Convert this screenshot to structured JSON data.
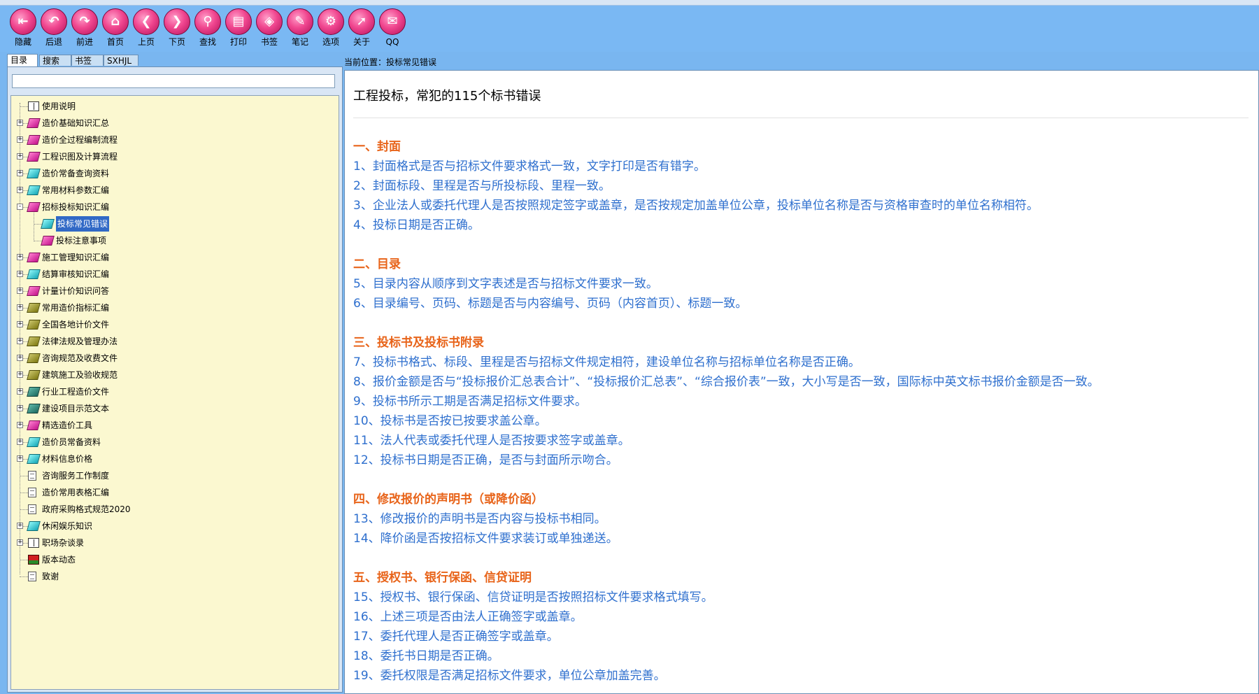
{
  "toolbar": {
    "buttons": [
      {
        "label": "隐藏",
        "icon": "hide-icon",
        "glyph": "⇤"
      },
      {
        "label": "后退",
        "icon": "back-icon",
        "glyph": "↶"
      },
      {
        "label": "前进",
        "icon": "forward-icon",
        "glyph": "↷"
      },
      {
        "label": "首页",
        "icon": "home-icon",
        "glyph": "⌂"
      },
      {
        "label": "上页",
        "icon": "prev-page-icon",
        "glyph": "❮"
      },
      {
        "label": "下页",
        "icon": "next-page-icon",
        "glyph": "❯"
      },
      {
        "label": "查找",
        "icon": "binoculars-icon",
        "glyph": "⚲"
      },
      {
        "label": "打印",
        "icon": "printer-icon",
        "glyph": "▤"
      },
      {
        "label": "书签",
        "icon": "bookmark-tag-icon",
        "glyph": "◈"
      },
      {
        "label": "笔记",
        "icon": "notes-icon",
        "glyph": "✎"
      },
      {
        "label": "选项",
        "icon": "gear-icon",
        "glyph": "⚙"
      },
      {
        "label": "关于",
        "icon": "cursor-icon",
        "glyph": "➚"
      },
      {
        "label": "QQ",
        "icon": "qq-icon",
        "glyph": "✉"
      }
    ]
  },
  "sidebar": {
    "tabs": [
      "目录",
      "搜索",
      "书签",
      "SXHJL"
    ],
    "active_tab": "目录",
    "search_value": "",
    "tree": [
      {
        "label": "使用说明",
        "icon": "book-open",
        "expander": "",
        "indent": 0
      },
      {
        "label": "造价基础知识汇总",
        "icon": "book-pink",
        "expander": "+",
        "indent": 0
      },
      {
        "label": "造价全过程编制流程",
        "icon": "book-pink",
        "expander": "+",
        "indent": 0
      },
      {
        "label": "工程识图及计算流程",
        "icon": "book-pink",
        "expander": "+",
        "indent": 0
      },
      {
        "label": "造价常备查询资料",
        "icon": "book-cyan",
        "expander": "+",
        "indent": 0
      },
      {
        "label": "常用材料参数汇编",
        "icon": "book-cyan",
        "expander": "+",
        "indent": 0
      },
      {
        "label": "招标投标知识汇编",
        "icon": "book-pink",
        "expander": "-",
        "indent": 0
      },
      {
        "label": "投标常见错误",
        "icon": "book-cyan",
        "expander": "",
        "indent": 1,
        "selected": true
      },
      {
        "label": "投标注意事项",
        "icon": "book-pink",
        "expander": "",
        "indent": 1
      },
      {
        "label": "施工管理知识汇编",
        "icon": "book-pink",
        "expander": "+",
        "indent": 0
      },
      {
        "label": "结算审核知识汇编",
        "icon": "book-cyan",
        "expander": "+",
        "indent": 0
      },
      {
        "label": "计量计价知识问答",
        "icon": "book-pink",
        "expander": "+",
        "indent": 0
      },
      {
        "label": "常用造价指标汇编",
        "icon": "book-olive",
        "expander": "+",
        "indent": 0
      },
      {
        "label": "全国各地计价文件",
        "icon": "book-olive",
        "expander": "+",
        "indent": 0
      },
      {
        "label": "法律法规及管理办法",
        "icon": "book-olive",
        "expander": "+",
        "indent": 0
      },
      {
        "label": "咨询规范及收费文件",
        "icon": "book-olive",
        "expander": "+",
        "indent": 0
      },
      {
        "label": "建筑施工及验收规范",
        "icon": "book-olive",
        "expander": "+",
        "indent": 0
      },
      {
        "label": "行业工程造价文件",
        "icon": "book-teal",
        "expander": "+",
        "indent": 0
      },
      {
        "label": "建设项目示范文本",
        "icon": "book-teal",
        "expander": "+",
        "indent": 0
      },
      {
        "label": "精选造价工具",
        "icon": "book-pink",
        "expander": "+",
        "indent": 0
      },
      {
        "label": "造价员常备资料",
        "icon": "book-cyan",
        "expander": "+",
        "indent": 0
      },
      {
        "label": "材料信息价格",
        "icon": "book-cyan",
        "expander": "+",
        "indent": 0
      },
      {
        "label": "咨询服务工作制度",
        "icon": "doc",
        "expander": "",
        "indent": 0
      },
      {
        "label": "造价常用表格汇编",
        "icon": "doc",
        "expander": "",
        "indent": 0
      },
      {
        "label": "政府采购格式规范2020",
        "icon": "doc",
        "expander": "",
        "indent": 0
      },
      {
        "label": "休闲娱乐知识",
        "icon": "book-cyan",
        "expander": "+",
        "indent": 0
      },
      {
        "label": "职场杂谈录",
        "icon": "book-open",
        "expander": "+",
        "indent": 0
      },
      {
        "label": "版本动态",
        "icon": "news",
        "expander": "",
        "indent": 0
      },
      {
        "label": "致谢",
        "icon": "doc",
        "expander": "",
        "indent": 0
      }
    ]
  },
  "location": {
    "label": "当前位置：",
    "value": "投标常见错误"
  },
  "content": {
    "title": "工程投标，常犯的115个标书错误",
    "blocks": [
      {
        "type": "section",
        "text": "一、封面"
      },
      {
        "type": "item",
        "text": "1、封面格式是否与招标文件要求格式一致，文字打印是否有错字。"
      },
      {
        "type": "item",
        "text": "2、封面标段、里程是否与所投标段、里程一致。"
      },
      {
        "type": "item",
        "text": "3、企业法人或委托代理人是否按照规定签字或盖章，是否按规定加盖单位公章，投标单位名称是否与资格审查时的单位名称相符。"
      },
      {
        "type": "item",
        "text": "4、投标日期是否正确。"
      },
      {
        "type": "gap"
      },
      {
        "type": "section",
        "text": "二、目录"
      },
      {
        "type": "item",
        "text": "5、目录内容从顺序到文字表述是否与招标文件要求一致。"
      },
      {
        "type": "item",
        "text": "6、目录编号、页码、标题是否与内容编号、页码（内容首页）、标题一致。"
      },
      {
        "type": "gap"
      },
      {
        "type": "section",
        "text": "三、投标书及投标书附录"
      },
      {
        "type": "item",
        "text": "7、投标书格式、标段、里程是否与招标文件规定相符，建设单位名称与招标单位名称是否正确。"
      },
      {
        "type": "item",
        "text": "8、报价金额是否与“投标报价汇总表合计”、“投标报价汇总表”、“综合报价表”一致，大小写是否一致，国际标中英文标书报价金额是否一致。"
      },
      {
        "type": "item",
        "text": "9、投标书所示工期是否满足招标文件要求。"
      },
      {
        "type": "item",
        "text": "10、投标书是否按已按要求盖公章。"
      },
      {
        "type": "item",
        "text": "11、法人代表或委托代理人是否按要求签字或盖章。"
      },
      {
        "type": "item",
        "text": "12、投标书日期是否正确，是否与封面所示吻合。"
      },
      {
        "type": "gap"
      },
      {
        "type": "section",
        "text": "四、修改报价的声明书（或降价函）"
      },
      {
        "type": "item",
        "text": "13、修改报价的声明书是否内容与投标书相同。"
      },
      {
        "type": "item",
        "text": "14、降价函是否按招标文件要求装订或单独递送。"
      },
      {
        "type": "gap"
      },
      {
        "type": "section",
        "text": "五、授权书、银行保函、信贷证明"
      },
      {
        "type": "item",
        "text": "15、授权书、银行保函、信贷证明是否按照招标文件要求格式填写。"
      },
      {
        "type": "item",
        "text": "16、上述三项是否由法人正确签字或盖章。"
      },
      {
        "type": "item",
        "text": "17、委托代理人是否正确签字或盖章。"
      },
      {
        "type": "item",
        "text": "18、委托书日期是否正确。"
      },
      {
        "type": "item",
        "text": "19、委托权限是否满足招标文件要求，单位公章加盖完善。"
      }
    ]
  },
  "colors": {
    "toolbar_bg": "#7ab8f3",
    "button_pink": "#f0468f",
    "tree_bg": "#fbf8d0",
    "section_orange": "#e8641a",
    "item_blue": "#2e6fce",
    "selection_blue": "#3169c6"
  }
}
